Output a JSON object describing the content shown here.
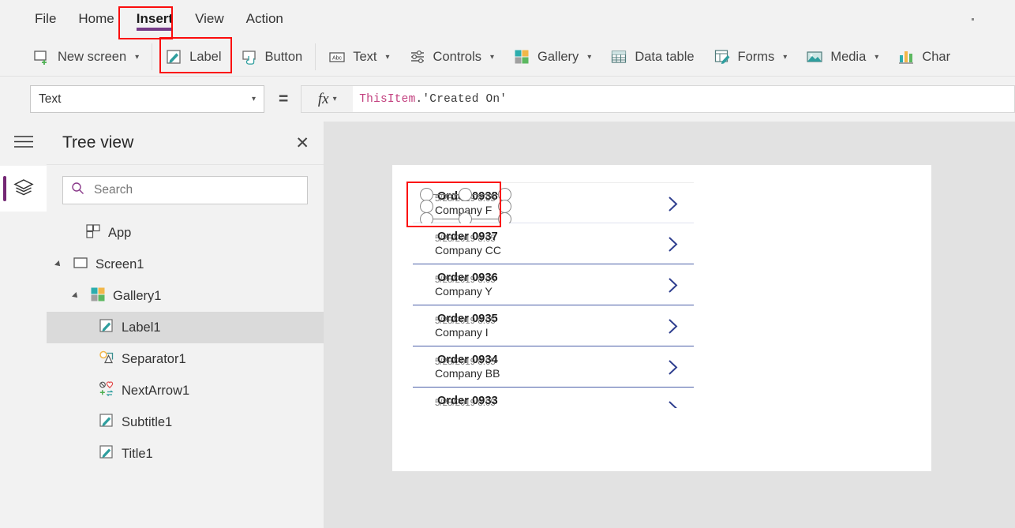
{
  "menubar": {
    "items": [
      {
        "label": "File",
        "active": false
      },
      {
        "label": "Home",
        "active": false
      },
      {
        "label": "Insert",
        "active": true
      },
      {
        "label": "View",
        "active": false
      },
      {
        "label": "Action",
        "active": false
      }
    ]
  },
  "ribbon": {
    "items": [
      {
        "label": "New screen",
        "icon": "new-screen-icon",
        "caret": true
      },
      {
        "label": "Label",
        "icon": "label-icon",
        "caret": false
      },
      {
        "label": "Button",
        "icon": "button-icon",
        "caret": false
      },
      {
        "label": "Text",
        "icon": "text-icon",
        "caret": true
      },
      {
        "label": "Controls",
        "icon": "controls-icon",
        "caret": true
      },
      {
        "label": "Gallery",
        "icon": "gallery-icon",
        "caret": true
      },
      {
        "label": "Data table",
        "icon": "data-table-icon",
        "caret": false
      },
      {
        "label": "Forms",
        "icon": "forms-icon",
        "caret": true
      },
      {
        "label": "Media",
        "icon": "media-icon",
        "caret": true
      },
      {
        "label": "Char",
        "icon": "chart-icon",
        "caret": false
      }
    ]
  },
  "formula_bar": {
    "property": "Text",
    "equals": "=",
    "fx_label": "fx",
    "formula_object": "ThisItem",
    "formula_rest": ".'Created On'"
  },
  "tree_view": {
    "title": "Tree view",
    "close_label": "✕",
    "search_placeholder": "Search",
    "search_value": "",
    "nodes": [
      {
        "label": "App",
        "indent": 0,
        "icon": "app-icon",
        "twisty": "none",
        "selected": false
      },
      {
        "label": "Screen1",
        "indent": 0,
        "icon": "screen-icon",
        "twisty": "expanded",
        "selected": false
      },
      {
        "label": "Gallery1",
        "indent": 1,
        "icon": "gallery-icon",
        "twisty": "expanded",
        "selected": false
      },
      {
        "label": "Label1",
        "indent": 2,
        "icon": "label-icon",
        "twisty": "none",
        "selected": true
      },
      {
        "label": "Separator1",
        "indent": 2,
        "icon": "separator-icon",
        "twisty": "none",
        "selected": false
      },
      {
        "label": "NextArrow1",
        "indent": 2,
        "icon": "next-arrow-icon",
        "twisty": "none",
        "selected": false
      },
      {
        "label": "Subtitle1",
        "indent": 2,
        "icon": "label-icon",
        "twisty": "none",
        "selected": false
      },
      {
        "label": "Title1",
        "indent": 2,
        "icon": "label-icon",
        "twisty": "none",
        "selected": false
      }
    ]
  },
  "canvas": {
    "gallery_rows": [
      {
        "title": "Order 0938",
        "date": "5/28/2019 8:05",
        "subtitle": "Company F",
        "selected": true
      },
      {
        "title": "Order 0937",
        "date": "5/28/2019 8:05",
        "subtitle": "Company CC",
        "selected": false
      },
      {
        "title": "Order 0936",
        "date": "5/28/2019 8:05",
        "subtitle": "Company Y",
        "selected": false
      },
      {
        "title": "Order 0935",
        "date": "5/28/2019 8:05",
        "subtitle": "Company I",
        "selected": false
      },
      {
        "title": "Order 0934",
        "date": "5/28/2019 8:05",
        "subtitle": "Company BB",
        "selected": false
      },
      {
        "title": "Order 0933",
        "date": "5/28/2019 8:05",
        "subtitle": "",
        "selected": false
      }
    ]
  },
  "colors": {
    "accent_purple": "#743a87",
    "annotation_red": "#fb0d0d",
    "chevron_navy": "#2f3f8f",
    "teal": "#2f9e9e",
    "selection_gray": "#dadada"
  }
}
